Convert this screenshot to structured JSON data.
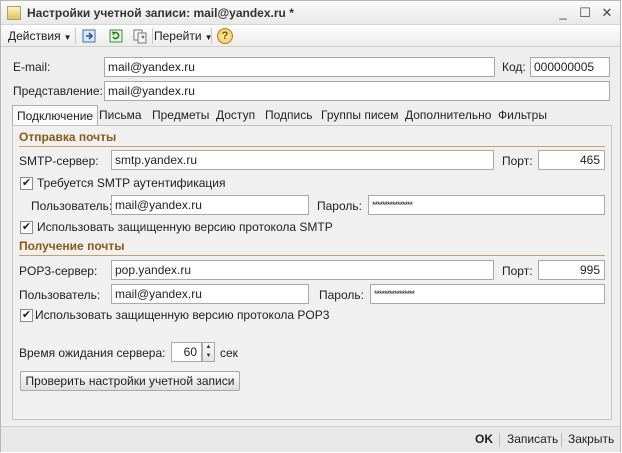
{
  "window": {
    "title": "Настройки учетной записи: mail@yandex.ru *",
    "controls": {
      "minimize": "_",
      "maximize": "☐",
      "close": "✕"
    }
  },
  "toolbar": {
    "actions_label": "Действия",
    "goto_label": "Перейти",
    "help_symbol": "?",
    "icons": [
      "save-to-list-icon",
      "refresh-icon",
      "copy-icon",
      "help-icon"
    ]
  },
  "header": {
    "email_label": "E-mail:",
    "email_value": "mail@yandex.ru",
    "code_label": "Код:",
    "code_value": "000000005",
    "representation_label": "Представление:",
    "representation_value": "mail@yandex.ru"
  },
  "tabs": [
    {
      "label": "Подключение",
      "active": true
    },
    {
      "label": "Письма",
      "active": false
    },
    {
      "label": "Предметы",
      "active": false
    },
    {
      "label": "Доступ",
      "active": false
    },
    {
      "label": "Подпись",
      "active": false
    },
    {
      "label": "Группы писем",
      "active": false
    },
    {
      "label": "Дополнительно",
      "active": false
    },
    {
      "label": "Фильтры",
      "active": false
    }
  ],
  "sending": {
    "title": "Отправка почты",
    "server_label": "SMTP-сервер:",
    "server_value": "smtp.yandex.ru",
    "port_label": "Порт:",
    "port_value": "465",
    "auth_required_label": "Требуется SMTP аутентификация",
    "auth_required_checked": true,
    "user_label": "Пользователь:",
    "user_value": "mail@yandex.ru",
    "password_label": "Пароль:",
    "password_value": "****************",
    "secure_label": "Использовать защищенную версию протокола SMTP",
    "secure_checked": true
  },
  "receiving": {
    "title": "Получение почты",
    "server_label": "POP3-сервер:",
    "server_value": "pop.yandex.ru",
    "port_label": "Порт:",
    "port_value": "995",
    "user_label": "Пользователь:",
    "user_value": "mail@yandex.ru",
    "password_label": "Пароль:",
    "password_value": "****************",
    "secure_label": "Использовать защищенную версию протокола POP3",
    "secure_checked": true
  },
  "timeout": {
    "label": "Время ожидания сервера:",
    "value": "60",
    "unit": "сек"
  },
  "check_button_label": "Проверить настройки учетной записи",
  "footer": {
    "ok_label": "OK",
    "save_label": "Записать",
    "close_label": "Закрыть"
  },
  "colors": {
    "section_title": "#8a5a12",
    "section_line": "#c8a060"
  },
  "check_mark": "✔"
}
